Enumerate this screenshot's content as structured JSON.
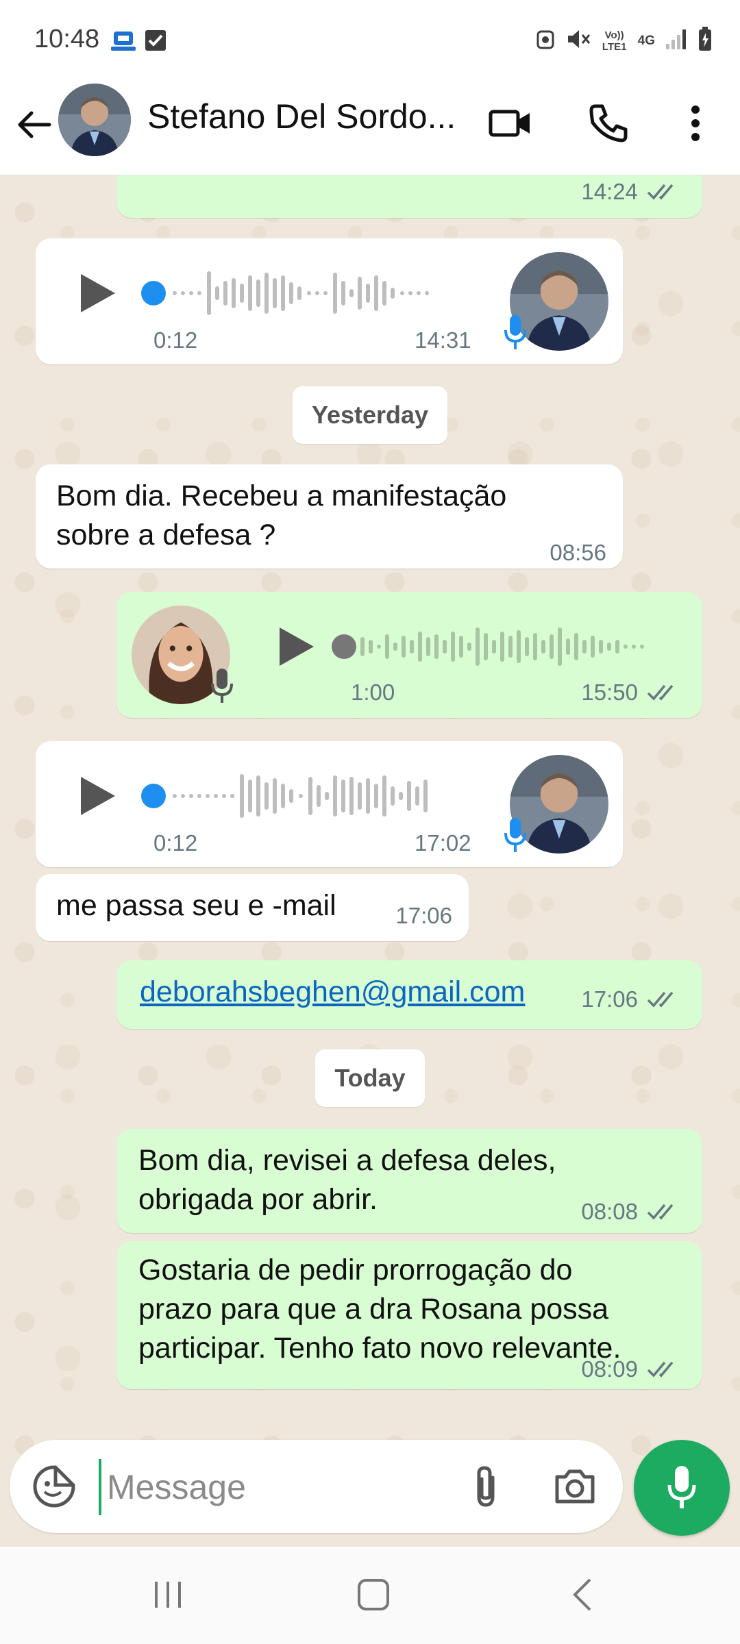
{
  "status_bar": {
    "time": "10:48",
    "network_volte": "Vo)) LTE1",
    "network_type": "4G",
    "icons": [
      "app-notification-icon",
      "checkbox-icon",
      "alarm-icon",
      "mute-icon",
      "signal-icon",
      "battery-icon"
    ]
  },
  "header": {
    "contact_name": "Stefano Del Sordo..."
  },
  "messages": {
    "m1": {
      "time": "14:24"
    },
    "m2": {
      "duration": "0:12",
      "time": "14:31"
    },
    "date_yesterday": "Yesterday",
    "m3": {
      "line1": "Bom dia. Recebeu a manifestação",
      "line2": "sobre a defesa ?",
      "time": "08:56"
    },
    "m4": {
      "duration": "1:00",
      "time": "15:50"
    },
    "m5": {
      "duration": "0:12",
      "time": "17:02"
    },
    "m6": {
      "text": "me passa seu e -mail",
      "time": "17:06"
    },
    "m7": {
      "text": "deborahsbeghen@gmail.com",
      "time": "17:06"
    },
    "date_today": "Today",
    "m8": {
      "line1": "Bom dia, revisei a defesa deles,",
      "line2": "obrigada por abrir.",
      "time": "08:08"
    },
    "m9": {
      "line1": "Gostaria de pedir prorrogação do",
      "line2": "prazo para que a dra Rosana possa",
      "line3": "participar. Tenho fato novo relevante.",
      "time": "08:09"
    }
  },
  "composer": {
    "placeholder": "Message"
  },
  "colors": {
    "accent": "#1daa61",
    "outgoing_bubble": "#d9fdd3",
    "incoming_bubble": "#ffffff",
    "voice_dot": "#1f8ef1",
    "read_ticks": "#667781"
  }
}
